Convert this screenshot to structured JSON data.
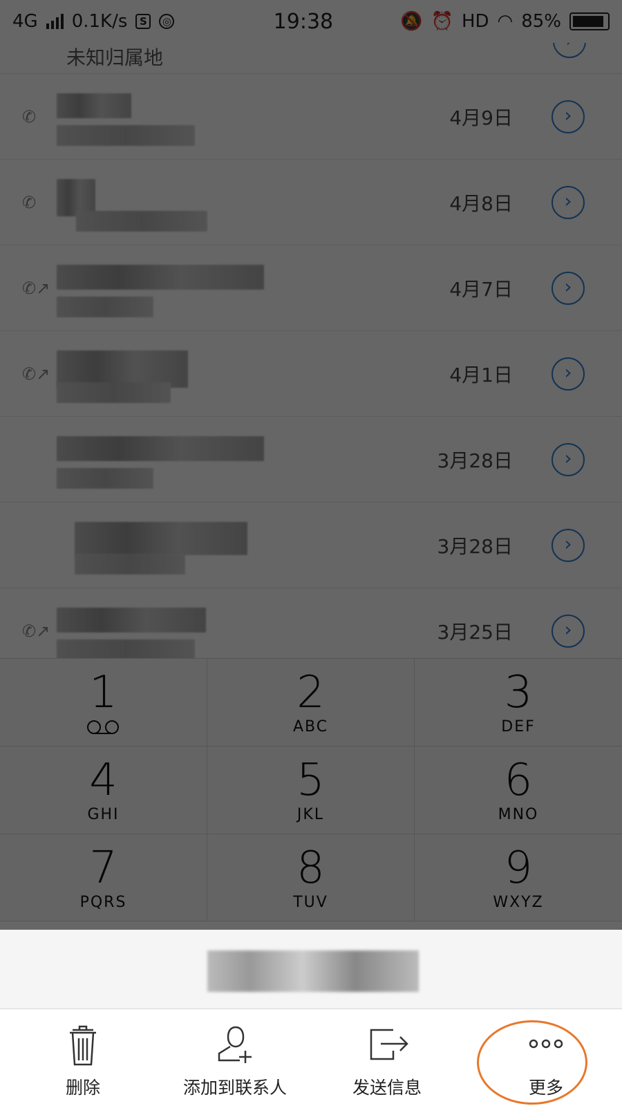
{
  "status_bar": {
    "network": "4G",
    "speed": "0.1K/s",
    "time": "19:38",
    "hd": "HD",
    "battery": "85%"
  },
  "call_list": {
    "partial_location": "未知归属地",
    "rows": [
      {
        "date": "4月9日",
        "outgoing": false
      },
      {
        "date": "4月8日",
        "outgoing": false
      },
      {
        "date": "4月7日",
        "outgoing": true
      },
      {
        "date": "4月1日",
        "outgoing": true
      },
      {
        "date": "3月28日",
        "outgoing": false
      },
      {
        "date": "3月28日",
        "outgoing": false
      },
      {
        "date": "3月25日",
        "outgoing": true
      }
    ]
  },
  "keypad": {
    "keys": [
      {
        "digit": "1",
        "letters": ""
      },
      {
        "digit": "2",
        "letters": "ABC"
      },
      {
        "digit": "3",
        "letters": "DEF"
      },
      {
        "digit": "4",
        "letters": "GHI"
      },
      {
        "digit": "5",
        "letters": "JKL"
      },
      {
        "digit": "6",
        "letters": "MNO"
      },
      {
        "digit": "7",
        "letters": "PQRS"
      },
      {
        "digit": "8",
        "letters": "TUV"
      },
      {
        "digit": "9",
        "letters": "WXYZ"
      }
    ]
  },
  "actions": {
    "delete": "删除",
    "add_contact": "添加到联系人",
    "send_message": "发送信息",
    "more": "更多"
  },
  "colors": {
    "accent_blue": "#2f7fd0",
    "highlight_orange": "#e8772a",
    "dim_overlay": "rgba(0,0,0,0.6)"
  },
  "icons": {
    "delete": "trash-icon",
    "add_contact": "add-person-icon",
    "send_message": "share-icon",
    "more": "more-dots-icon",
    "info": "chevron-right-circle-icon",
    "voicemail": "voicemail-icon"
  }
}
